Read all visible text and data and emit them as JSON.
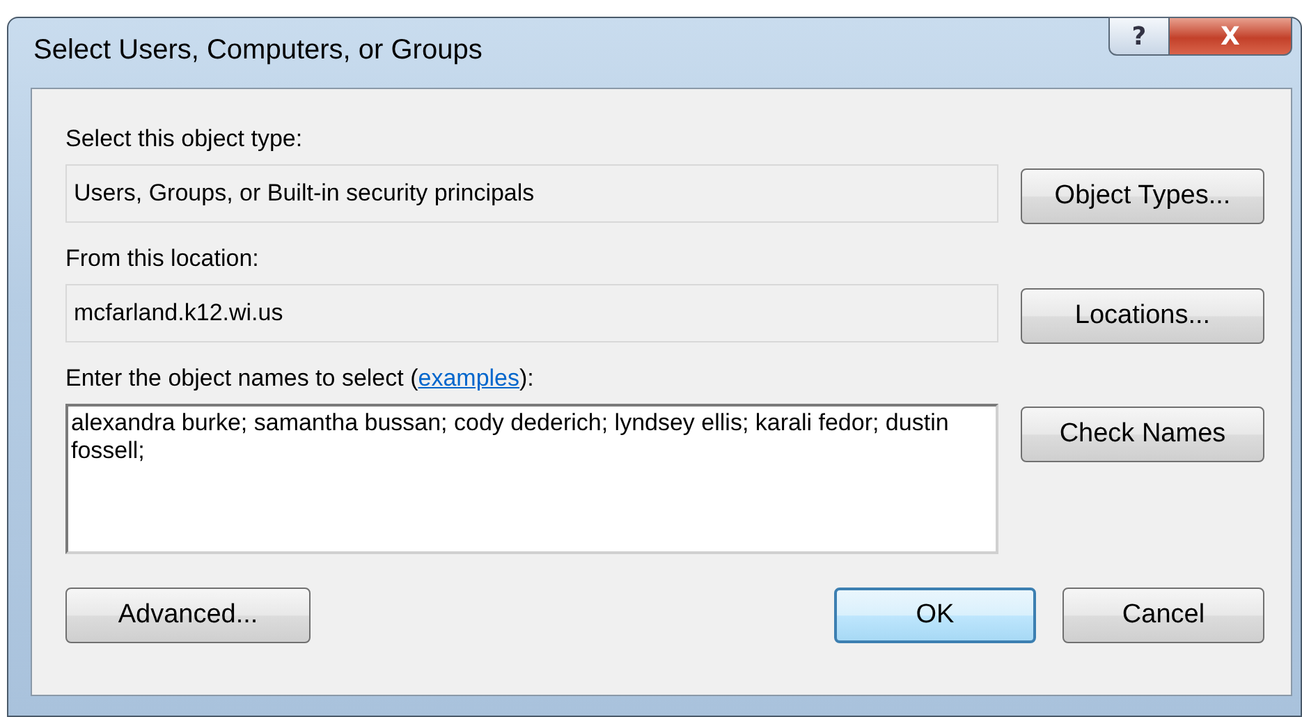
{
  "window": {
    "title": "Select Users, Computers, or Groups",
    "help_button": "?",
    "close_button": "X"
  },
  "object_type": {
    "label": "Select this object type:",
    "value": "Users, Groups, or Built-in security principals",
    "button": "Object Types..."
  },
  "location": {
    "label": "From this location:",
    "value": "mcfarland.k12.wi.us",
    "button": "Locations..."
  },
  "names": {
    "label": "Enter the object names to select (",
    "link": "examples",
    "label_end": "):",
    "value": "alexandra burke; samantha bussan; cody dederich; lyndsey ellis; karali fedor; dustin fossell;",
    "button": "Check Names"
  },
  "buttons": [
    {
      "label": "Advanced...",
      "default": false
    },
    {
      "label": "OK",
      "default": true
    },
    {
      "label": "Cancel",
      "default": false
    }
  ]
}
